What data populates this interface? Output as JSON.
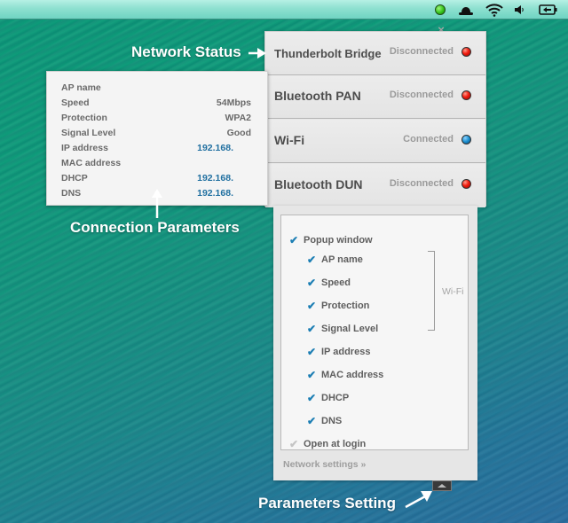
{
  "menubar": {
    "icons": [
      {
        "name": "network-status-indicator",
        "glyph": "●",
        "color": "#34c21a"
      },
      {
        "name": "hat-icon",
        "glyph": "hat"
      },
      {
        "name": "wifi-icon",
        "glyph": "wifi"
      },
      {
        "name": "volume-icon",
        "glyph": "🔈"
      },
      {
        "name": "battery-charging-icon",
        "glyph": "battery"
      }
    ]
  },
  "popup": {
    "close_glyph": "×",
    "connections": [
      {
        "name": "Thunderbolt Bridge",
        "status": "Disconnected",
        "led": "red"
      },
      {
        "name": "Bluetooth PAN",
        "status": "Disconnected",
        "led": "red"
      },
      {
        "name": "Wi-Fi",
        "status": "Connected",
        "led": "blue"
      },
      {
        "name": "Bluetooth DUN",
        "status": "Disconnected",
        "led": "red"
      }
    ]
  },
  "params": {
    "rows": [
      {
        "label": "AP name",
        "value": ""
      },
      {
        "label": "Speed",
        "value": "54Mbps"
      },
      {
        "label": "Protection",
        "value": "WPA2"
      },
      {
        "label": "Signal Level",
        "value": "Good"
      },
      {
        "label": "IP address",
        "value": "192.168."
      },
      {
        "label": "MAC address",
        "value": ""
      },
      {
        "label": "DHCP",
        "value": "192.168."
      },
      {
        "label": "DNS",
        "value": "192.168."
      }
    ]
  },
  "settings": {
    "options": [
      {
        "label": "Popup window",
        "checked": true,
        "indent": 0
      },
      {
        "label": "AP name",
        "checked": true,
        "indent": 1
      },
      {
        "label": "Speed",
        "checked": true,
        "indent": 1
      },
      {
        "label": "Protection",
        "checked": true,
        "indent": 1
      },
      {
        "label": "Signal Level",
        "checked": true,
        "indent": 1
      },
      {
        "label": "IP address",
        "checked": true,
        "indent": 1
      },
      {
        "label": "MAC address",
        "checked": true,
        "indent": 1
      },
      {
        "label": "DHCP",
        "checked": true,
        "indent": 1
      },
      {
        "label": "DNS",
        "checked": true,
        "indent": 1
      },
      {
        "label": "Open at login",
        "checked": false,
        "indent": 0
      }
    ],
    "group_label": "Wi-Fi",
    "check_glyph": "✔",
    "network_settings_link": "Network settings »"
  },
  "annotations": {
    "network_status": "Network Status",
    "connection_parameters": "Connection Parameters",
    "parameters_setting": "Parameters Setting"
  },
  "colors": {
    "accent": "#1d7fb4",
    "ip_value": "#1f6fa0",
    "led_red": "#f21d10",
    "led_blue": "#1a8fd0",
    "led_green": "#34c21a"
  }
}
